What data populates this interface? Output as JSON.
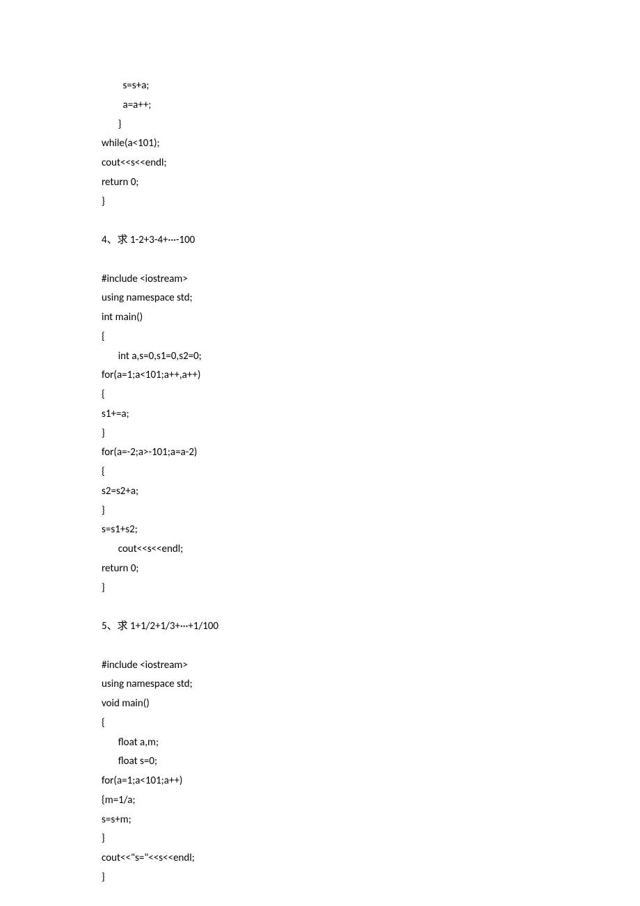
{
  "lines": [
    "         s=s+a;",
    "         a=a++;",
    "       }",
    "while(a<101);",
    "cout<<s<<endl;",
    "return 0;",
    "}",
    "",
    "4、求 1-2+3-4+···-100",
    "",
    "#include <iostream>",
    "using namespace std;",
    "int main()",
    "{",
    "       int a,s=0,s1=0,s2=0;",
    "for(a=1;a<101;a++,a++)",
    "{",
    "s1+=a;",
    "}",
    "for(a=-2;a>-101;a=a-2)",
    "{",
    "s2=s2+a;",
    "}",
    "s=s1+s2;",
    "       cout<<s<<endl;",
    "return 0;",
    "}",
    "",
    "5、求 1+1/2+1/3+···+1/100",
    "",
    "#include <iostream>",
    "using namespace std;",
    "void main()",
    "{",
    "       float a,m;",
    "       float s=0;",
    "for(a=1;a<101;a++)",
    "{m=1/a;",
    "s=s+m;",
    "}",
    "cout<<\"s=\"<<s<<endl;",
    "}"
  ]
}
